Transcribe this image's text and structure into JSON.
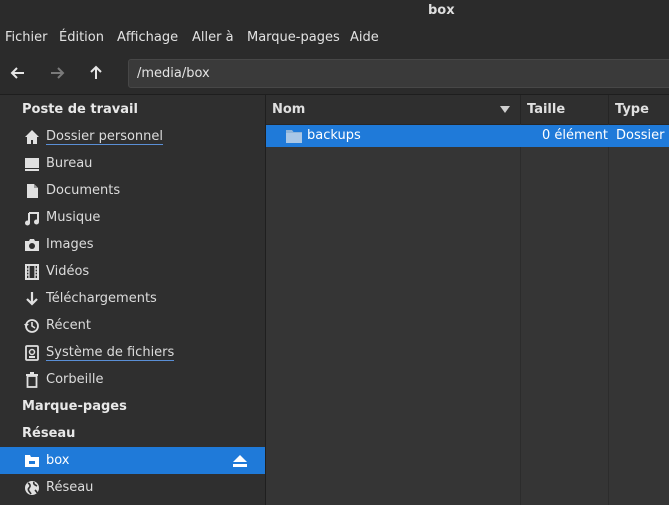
{
  "window": {
    "title": "box"
  },
  "menu": [
    "Fichier",
    "Édition",
    "Affichage",
    "Aller à",
    "Marque-pages",
    "Aide"
  ],
  "toolbar": {
    "path": "/media/box"
  },
  "sidebar": {
    "sections": [
      {
        "label": "Poste de travail",
        "expanded": true
      },
      {
        "label": "Marque-pages",
        "expanded": false
      },
      {
        "label": "Réseau",
        "expanded": true
      }
    ],
    "places": [
      {
        "label": "Dossier personnel",
        "icon": "home-icon"
      },
      {
        "label": "Bureau",
        "icon": "desktop-icon"
      },
      {
        "label": "Documents",
        "icon": "document-icon"
      },
      {
        "label": "Musique",
        "icon": "music-icon"
      },
      {
        "label": "Images",
        "icon": "camera-icon"
      },
      {
        "label": "Vidéos",
        "icon": "film-icon"
      },
      {
        "label": "Téléchargements",
        "icon": "download-icon"
      },
      {
        "label": "Récent",
        "icon": "recent-icon"
      },
      {
        "label": "Système de fichiers",
        "icon": "drive-icon"
      },
      {
        "label": "Corbeille",
        "icon": "trash-icon"
      }
    ],
    "network": [
      {
        "label": "box",
        "icon": "network-drive-icon",
        "selected": true
      },
      {
        "label": "Réseau",
        "icon": "globe-icon"
      }
    ]
  },
  "columns": {
    "name": "Nom",
    "size": "Taille",
    "type": "Type"
  },
  "files": [
    {
      "name": "backups",
      "size": "0 élément",
      "type": "Dossier"
    }
  ],
  "colors": {
    "accent": "#1f7ad9",
    "background": "#2f2f2f"
  }
}
